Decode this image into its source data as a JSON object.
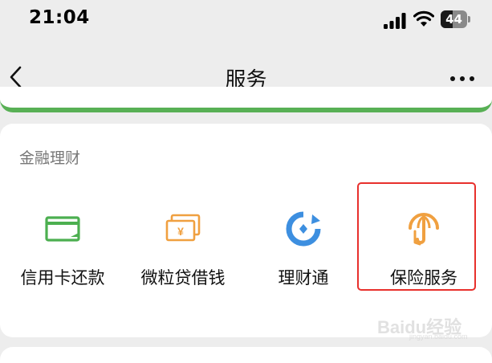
{
  "status_bar": {
    "time": "21:04",
    "battery": "44",
    "battery_level": 0.44,
    "icons": [
      "signal-icon",
      "wifi-icon",
      "battery-icon"
    ]
  },
  "nav": {
    "title": "服务",
    "back_icon": "chevron-left-icon",
    "more_icon": "more-dots-icon"
  },
  "section": {
    "title": "金融理财",
    "items": [
      {
        "label": "信用卡还款",
        "icon": "credit-card-icon",
        "color": "#4caf50"
      },
      {
        "label": "微粒贷借钱",
        "icon": "money-bill-icon",
        "color": "#f0a040"
      },
      {
        "label": "理财通",
        "icon": "wealth-icon",
        "color": "#3d8fe0"
      },
      {
        "label": "保险服务",
        "icon": "insurance-umbrella-icon",
        "color": "#f0a040"
      }
    ]
  },
  "watermark": {
    "brand": "Baidu",
    "cn": "经验",
    "url": "jingyan.baidu.com"
  },
  "colors": {
    "background": "#ededed",
    "card": "#ffffff",
    "accent_green": "#58b055",
    "highlight": "#e8302c"
  }
}
